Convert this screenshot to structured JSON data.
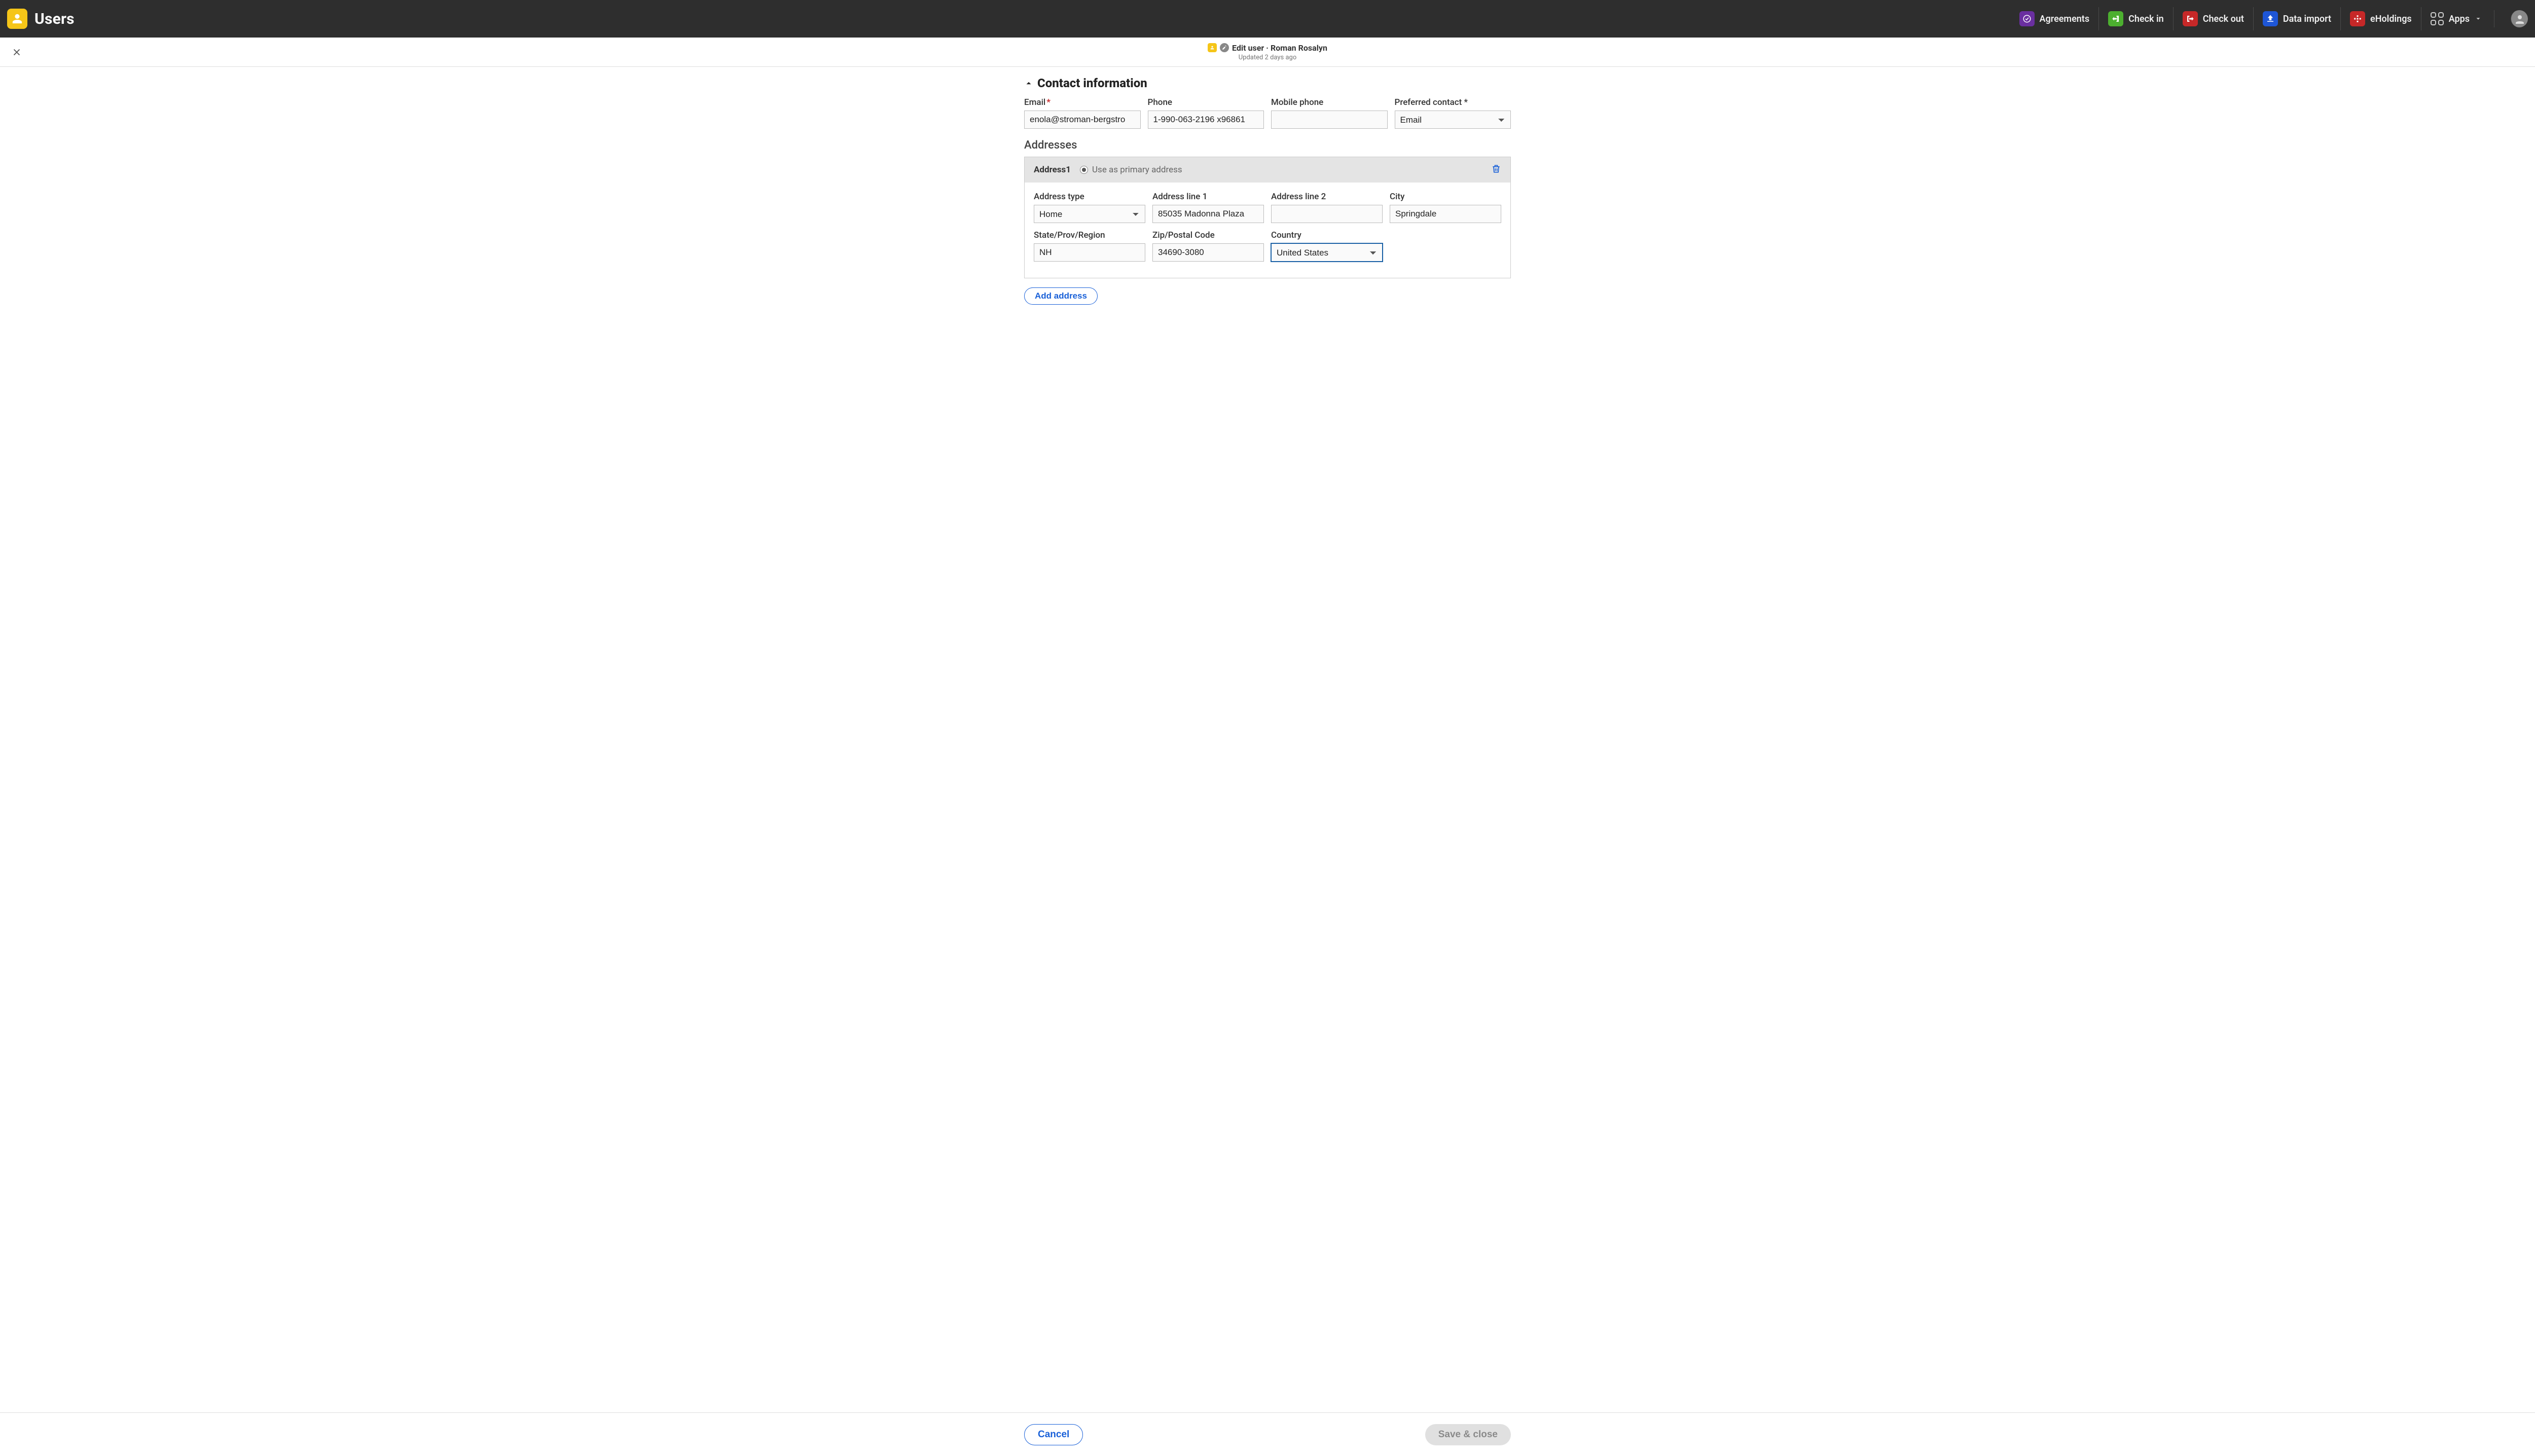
{
  "topbar": {
    "app_title": "Users",
    "nav": [
      {
        "label": "Agreements",
        "color": "#6a2fa0",
        "icon": "agreements"
      },
      {
        "label": "Check in",
        "color": "#4caf2f",
        "icon": "checkin"
      },
      {
        "label": "Check out",
        "color": "#c62828",
        "icon": "checkout"
      },
      {
        "label": "Data import",
        "color": "#1e56d6",
        "icon": "dataimport"
      },
      {
        "label": "eHoldings",
        "color": "#c62828",
        "icon": "eholdings"
      }
    ],
    "apps_label": "Apps"
  },
  "pane": {
    "title": "Edit user · Roman Rosalyn",
    "subtitle": "Updated 2 days ago"
  },
  "section": {
    "contact_heading": "Contact information",
    "email_label": "Email",
    "email_value": "enola@stroman-bergstro",
    "phone_label": "Phone",
    "phone_value": "1-990-063-2196 x96861",
    "mobile_label": "Mobile phone",
    "mobile_value": "",
    "preferred_label": "Preferred contact *",
    "preferred_value": "Email",
    "addresses_heading": "Addresses",
    "address1": {
      "title": "Address1",
      "primary_label": "Use as primary address",
      "type_label": "Address type",
      "type_value": "Home",
      "line1_label": "Address line 1",
      "line1_value": "85035 Madonna Plaza",
      "line2_label": "Address line 2",
      "line2_value": "",
      "city_label": "City",
      "city_value": "Springdale",
      "state_label": "State/Prov/Region",
      "state_value": "NH",
      "zip_label": "Zip/Postal Code",
      "zip_value": "34690-3080",
      "country_label": "Country",
      "country_value": "United States"
    },
    "add_address_label": "Add address"
  },
  "footer": {
    "cancel_label": "Cancel",
    "save_label": "Save & close"
  }
}
